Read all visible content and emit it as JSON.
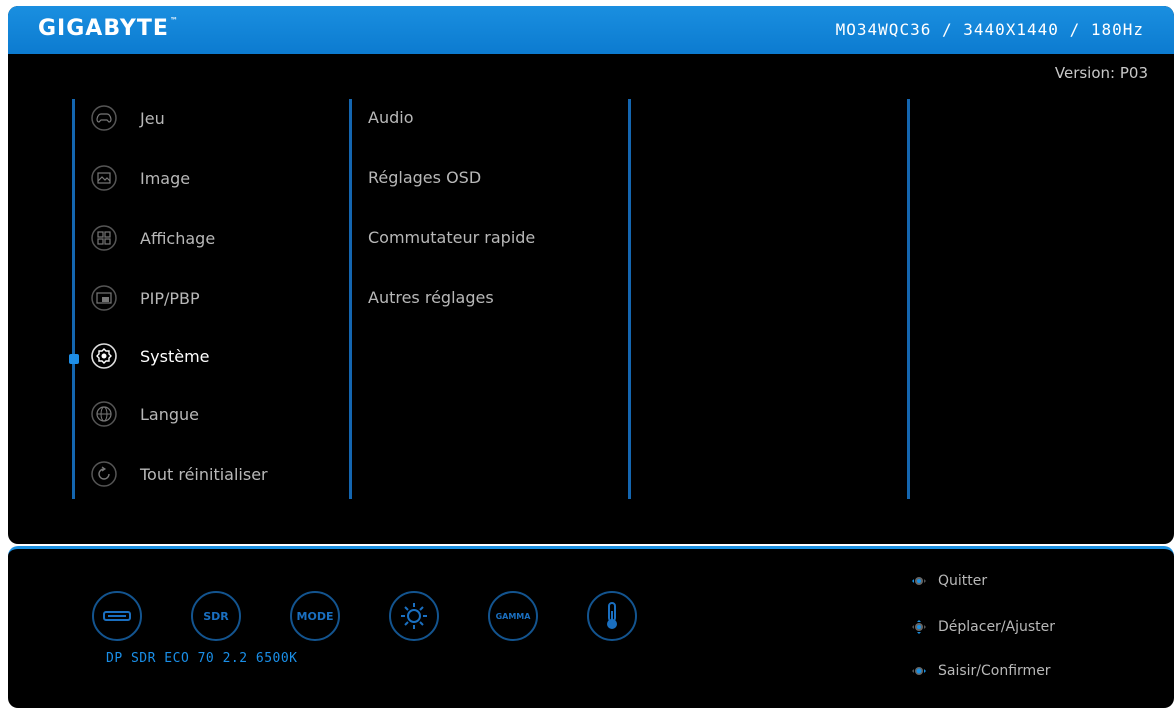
{
  "header": {
    "brand": "GIGABYTE",
    "brand_tm": "™",
    "model_info": "MO34WQC36  /  3440X1440 / 180Hz",
    "version": "Version: P03",
    "accent_color": "#1a8fe0"
  },
  "main_menu": {
    "items": [
      {
        "label": "Jeu",
        "icon": "gamepad-icon"
      },
      {
        "label": "Image",
        "icon": "picture-icon"
      },
      {
        "label": "Affichage",
        "icon": "display-grid-icon"
      },
      {
        "label": "PIP/PBP",
        "icon": "pip-icon"
      },
      {
        "label": "Système",
        "icon": "gear-icon",
        "active": true
      },
      {
        "label": "Langue",
        "icon": "globe-icon"
      },
      {
        "label": "Tout réinitialiser",
        "icon": "reset-icon"
      }
    ]
  },
  "sub_menu": {
    "items": [
      {
        "label": "Audio"
      },
      {
        "label": "Réglages OSD"
      },
      {
        "label": "Commutateur rapide"
      },
      {
        "label": "Autres réglages"
      }
    ]
  },
  "quick_bar": {
    "buttons": [
      {
        "name": "input-source-icon",
        "label": ""
      },
      {
        "name": "sdr-button",
        "label": "SDR"
      },
      {
        "name": "mode-button",
        "label": "MODE"
      },
      {
        "name": "brightness-icon",
        "label": ""
      },
      {
        "name": "gamma-button",
        "label": "GAMMA"
      },
      {
        "name": "thermometer-icon",
        "label": ""
      }
    ],
    "status": "DP SDR ECO 70 2.2 6500K"
  },
  "hints": {
    "items": [
      {
        "label": "Quitter",
        "icon": "joystick-left-icon"
      },
      {
        "label": "Déplacer/Ajuster",
        "icon": "joystick-move-icon"
      },
      {
        "label": "Saisir/Confirmer",
        "icon": "joystick-press-icon"
      }
    ]
  }
}
